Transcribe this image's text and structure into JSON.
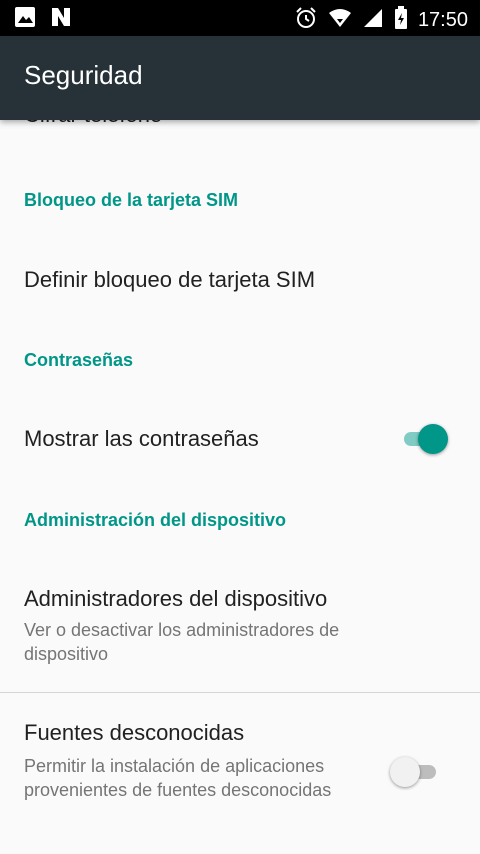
{
  "status_bar": {
    "time": "17:50",
    "icons": [
      "image-icon",
      "n-notification-icon",
      "alarm-icon",
      "wifi-icon",
      "signal-icon",
      "battery-icon"
    ]
  },
  "app_bar": {
    "title": "Seguridad"
  },
  "list": {
    "cut_item": "Cifrar teléfono",
    "sim_header": "Bloqueo de la tarjeta SIM",
    "sim_lock": "Definir bloqueo de tarjeta SIM",
    "passwords_header": "Contraseñas",
    "show_passwords": "Mostrar las contraseñas",
    "show_passwords_enabled": true,
    "device_admin_header": "Administración del dispositivo",
    "device_admins_title": "Administradores del dispositivo",
    "device_admins_sub": "Ver o desactivar los administradores de dispositivo",
    "unknown_sources_title": "Fuentes desconocidas",
    "unknown_sources_sub": "Permitir la instalación de aplicaciones provenientes de fuentes desconocidas",
    "unknown_sources_enabled": false
  },
  "colors": {
    "accent": "#009688",
    "app_bar": "#263238",
    "status_bar": "#000000",
    "background": "#fafafa"
  }
}
